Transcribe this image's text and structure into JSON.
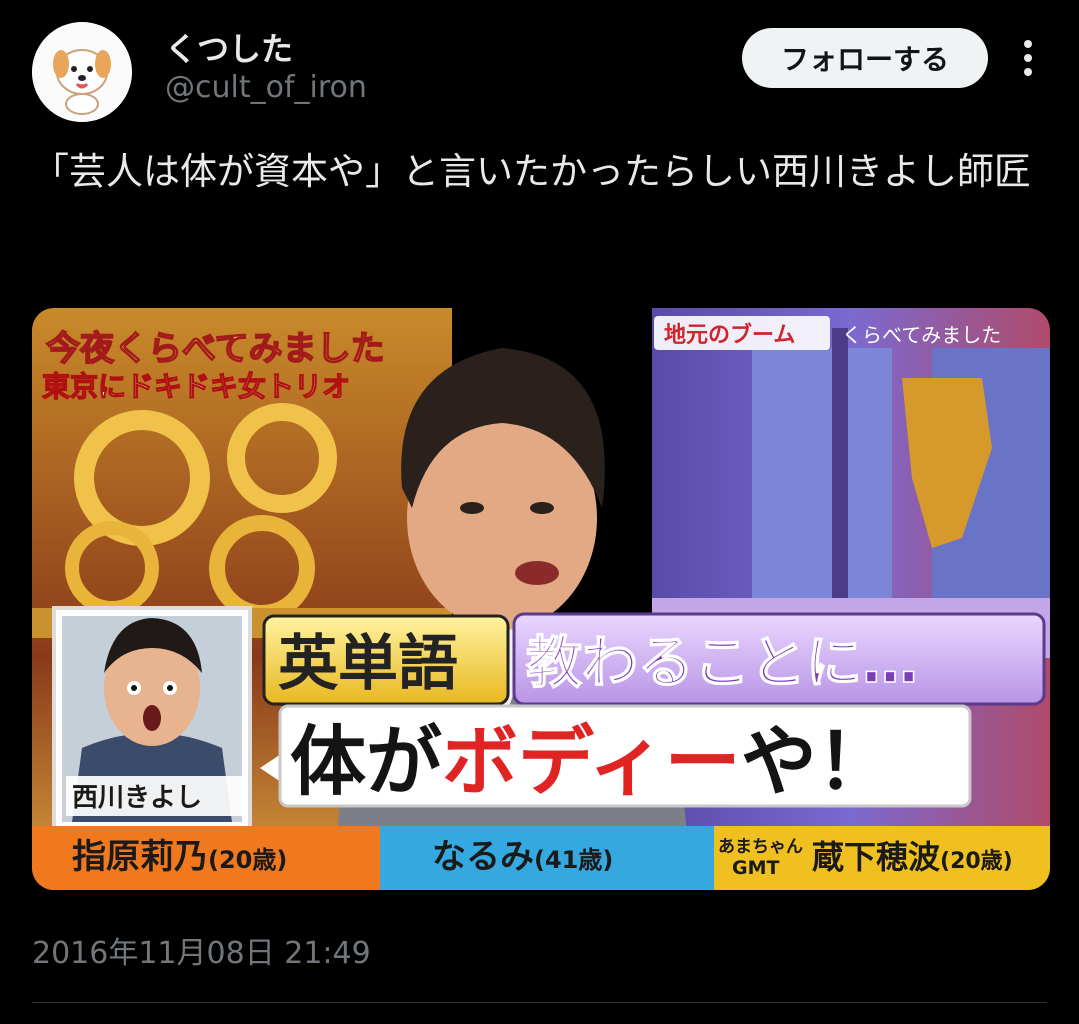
{
  "author": {
    "display_name": "くつした",
    "handle": "@cult_of_iron",
    "avatar_icon": "dog-icon"
  },
  "actions": {
    "follow_label": "フォローする",
    "more_icon": "more-vertical-icon"
  },
  "tweet": {
    "text": "「芸人は体が資本や」と言いたかったらしい西川きよし師匠",
    "timestamp": "2016年11月08日 21:49"
  },
  "media": {
    "logo_line1": "今夜くらべてみました",
    "logo_line2": "東京にドキドキ女トリオ",
    "corner_tag": "地元のブーム",
    "corner_sub": "くらべてみました",
    "caption_word1": "英単語",
    "caption_word2": "教わることに…",
    "quote_part1": "体が",
    "quote_part2": "ボディー",
    "quote_part3": "や！",
    "inset_name": "西川きよし",
    "name_left": "指原莉乃",
    "age_left": "(20歳)",
    "name_mid": "なるみ",
    "age_mid": "(41歳)",
    "name_right_prefix1": "あまちゃん",
    "name_right_prefix2": "GMT",
    "name_right": "蔵下穂波",
    "age_right": "(20歳)"
  },
  "colors": {
    "background": "#000000",
    "text_primary": "#e7e9ea",
    "text_secondary": "#71767b",
    "follow_bg": "#eff3f4",
    "follow_text": "#0f1419",
    "divider": "#2f3336",
    "caption_yellow": "#f3d43a",
    "caption_purple": "#9b59c6",
    "quote_red": "#e02323"
  }
}
